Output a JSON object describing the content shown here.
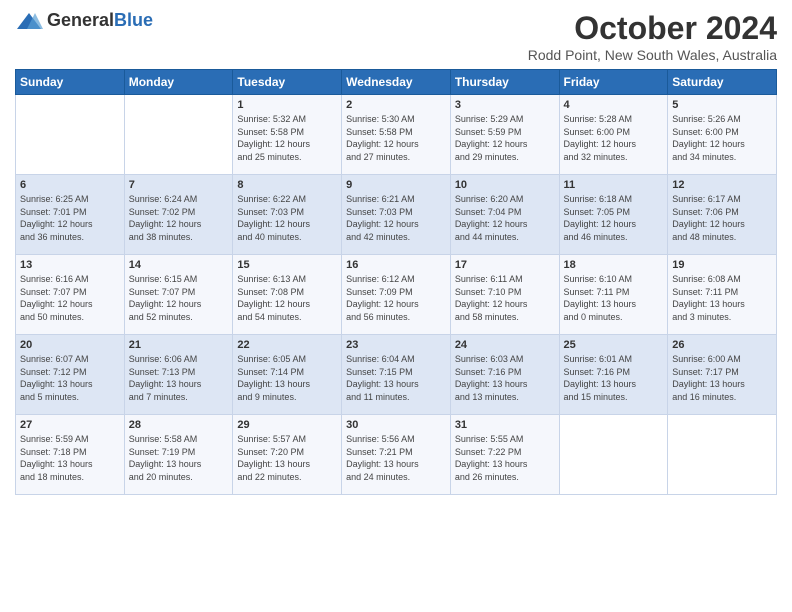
{
  "logo": {
    "general": "General",
    "blue": "Blue"
  },
  "title": "October 2024",
  "location": "Rodd Point, New South Wales, Australia",
  "days_header": [
    "Sunday",
    "Monday",
    "Tuesday",
    "Wednesday",
    "Thursday",
    "Friday",
    "Saturday"
  ],
  "weeks": [
    [
      {
        "day": "",
        "info": ""
      },
      {
        "day": "",
        "info": ""
      },
      {
        "day": "1",
        "info": "Sunrise: 5:32 AM\nSunset: 5:58 PM\nDaylight: 12 hours\nand 25 minutes."
      },
      {
        "day": "2",
        "info": "Sunrise: 5:30 AM\nSunset: 5:58 PM\nDaylight: 12 hours\nand 27 minutes."
      },
      {
        "day": "3",
        "info": "Sunrise: 5:29 AM\nSunset: 5:59 PM\nDaylight: 12 hours\nand 29 minutes."
      },
      {
        "day": "4",
        "info": "Sunrise: 5:28 AM\nSunset: 6:00 PM\nDaylight: 12 hours\nand 32 minutes."
      },
      {
        "day": "5",
        "info": "Sunrise: 5:26 AM\nSunset: 6:00 PM\nDaylight: 12 hours\nand 34 minutes."
      }
    ],
    [
      {
        "day": "6",
        "info": "Sunrise: 6:25 AM\nSunset: 7:01 PM\nDaylight: 12 hours\nand 36 minutes."
      },
      {
        "day": "7",
        "info": "Sunrise: 6:24 AM\nSunset: 7:02 PM\nDaylight: 12 hours\nand 38 minutes."
      },
      {
        "day": "8",
        "info": "Sunrise: 6:22 AM\nSunset: 7:03 PM\nDaylight: 12 hours\nand 40 minutes."
      },
      {
        "day": "9",
        "info": "Sunrise: 6:21 AM\nSunset: 7:03 PM\nDaylight: 12 hours\nand 42 minutes."
      },
      {
        "day": "10",
        "info": "Sunrise: 6:20 AM\nSunset: 7:04 PM\nDaylight: 12 hours\nand 44 minutes."
      },
      {
        "day": "11",
        "info": "Sunrise: 6:18 AM\nSunset: 7:05 PM\nDaylight: 12 hours\nand 46 minutes."
      },
      {
        "day": "12",
        "info": "Sunrise: 6:17 AM\nSunset: 7:06 PM\nDaylight: 12 hours\nand 48 minutes."
      }
    ],
    [
      {
        "day": "13",
        "info": "Sunrise: 6:16 AM\nSunset: 7:07 PM\nDaylight: 12 hours\nand 50 minutes."
      },
      {
        "day": "14",
        "info": "Sunrise: 6:15 AM\nSunset: 7:07 PM\nDaylight: 12 hours\nand 52 minutes."
      },
      {
        "day": "15",
        "info": "Sunrise: 6:13 AM\nSunset: 7:08 PM\nDaylight: 12 hours\nand 54 minutes."
      },
      {
        "day": "16",
        "info": "Sunrise: 6:12 AM\nSunset: 7:09 PM\nDaylight: 12 hours\nand 56 minutes."
      },
      {
        "day": "17",
        "info": "Sunrise: 6:11 AM\nSunset: 7:10 PM\nDaylight: 12 hours\nand 58 minutes."
      },
      {
        "day": "18",
        "info": "Sunrise: 6:10 AM\nSunset: 7:11 PM\nDaylight: 13 hours\nand 0 minutes."
      },
      {
        "day": "19",
        "info": "Sunrise: 6:08 AM\nSunset: 7:11 PM\nDaylight: 13 hours\nand 3 minutes."
      }
    ],
    [
      {
        "day": "20",
        "info": "Sunrise: 6:07 AM\nSunset: 7:12 PM\nDaylight: 13 hours\nand 5 minutes."
      },
      {
        "day": "21",
        "info": "Sunrise: 6:06 AM\nSunset: 7:13 PM\nDaylight: 13 hours\nand 7 minutes."
      },
      {
        "day": "22",
        "info": "Sunrise: 6:05 AM\nSunset: 7:14 PM\nDaylight: 13 hours\nand 9 minutes."
      },
      {
        "day": "23",
        "info": "Sunrise: 6:04 AM\nSunset: 7:15 PM\nDaylight: 13 hours\nand 11 minutes."
      },
      {
        "day": "24",
        "info": "Sunrise: 6:03 AM\nSunset: 7:16 PM\nDaylight: 13 hours\nand 13 minutes."
      },
      {
        "day": "25",
        "info": "Sunrise: 6:01 AM\nSunset: 7:16 PM\nDaylight: 13 hours\nand 15 minutes."
      },
      {
        "day": "26",
        "info": "Sunrise: 6:00 AM\nSunset: 7:17 PM\nDaylight: 13 hours\nand 16 minutes."
      }
    ],
    [
      {
        "day": "27",
        "info": "Sunrise: 5:59 AM\nSunset: 7:18 PM\nDaylight: 13 hours\nand 18 minutes."
      },
      {
        "day": "28",
        "info": "Sunrise: 5:58 AM\nSunset: 7:19 PM\nDaylight: 13 hours\nand 20 minutes."
      },
      {
        "day": "29",
        "info": "Sunrise: 5:57 AM\nSunset: 7:20 PM\nDaylight: 13 hours\nand 22 minutes."
      },
      {
        "day": "30",
        "info": "Sunrise: 5:56 AM\nSunset: 7:21 PM\nDaylight: 13 hours\nand 24 minutes."
      },
      {
        "day": "31",
        "info": "Sunrise: 5:55 AM\nSunset: 7:22 PM\nDaylight: 13 hours\nand 26 minutes."
      },
      {
        "day": "",
        "info": ""
      },
      {
        "day": "",
        "info": ""
      }
    ]
  ]
}
